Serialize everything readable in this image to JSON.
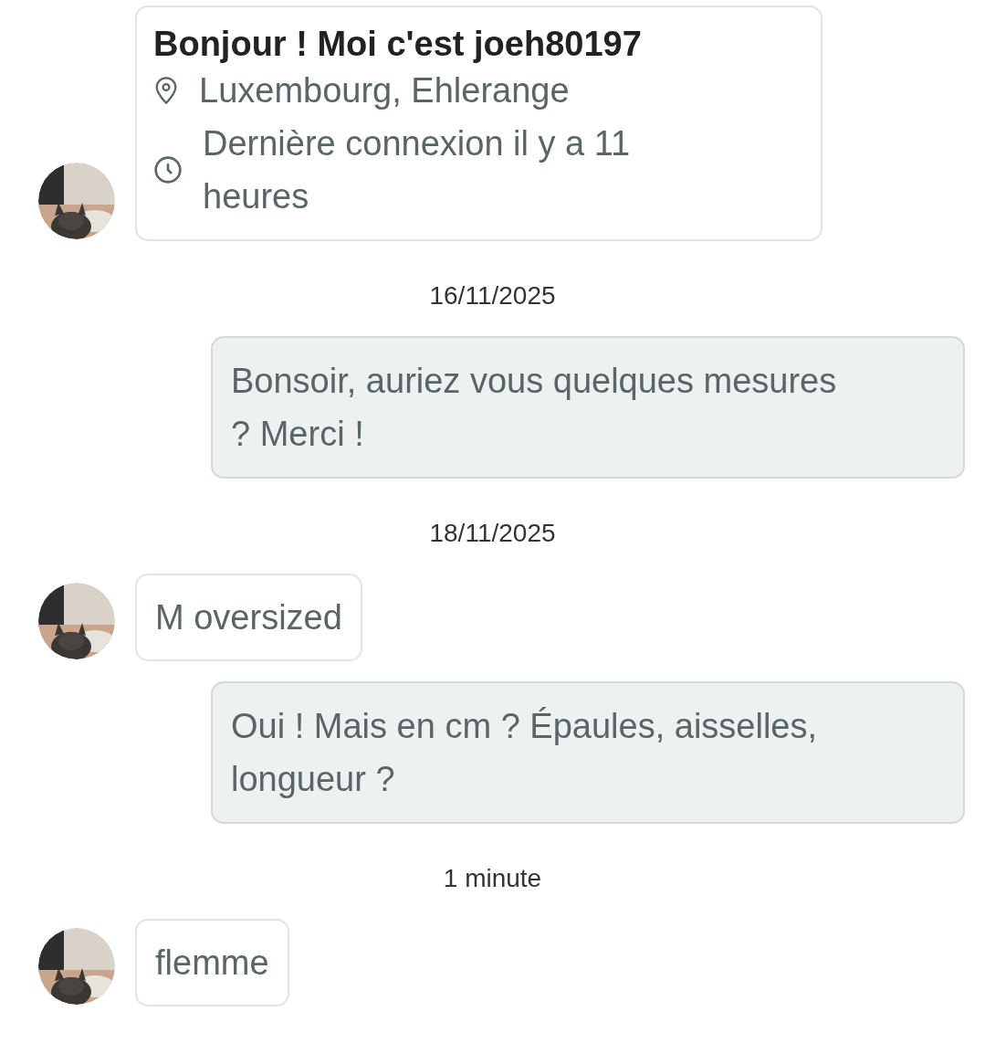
{
  "messages": [
    {
      "kind": "profile",
      "title": "Bonjour ! Moi c'est joeh80197",
      "location": "Luxembourg, Ehlerange",
      "last_seen": "Dernière connexion il y a 11 heures"
    },
    {
      "kind": "date",
      "text": "16/11/2025"
    },
    {
      "kind": "outgoing",
      "text": "Bonsoir, auriez vous quelques mesures ? Merci !"
    },
    {
      "kind": "date",
      "text": "18/11/2025"
    },
    {
      "kind": "incoming",
      "text": "M oversized"
    },
    {
      "kind": "outgoing",
      "text": "Oui ! Mais en cm ? Épaules, aisselles, longueur ?"
    },
    {
      "kind": "date",
      "text": "1 minute"
    },
    {
      "kind": "incoming",
      "text": "flemme"
    }
  ]
}
